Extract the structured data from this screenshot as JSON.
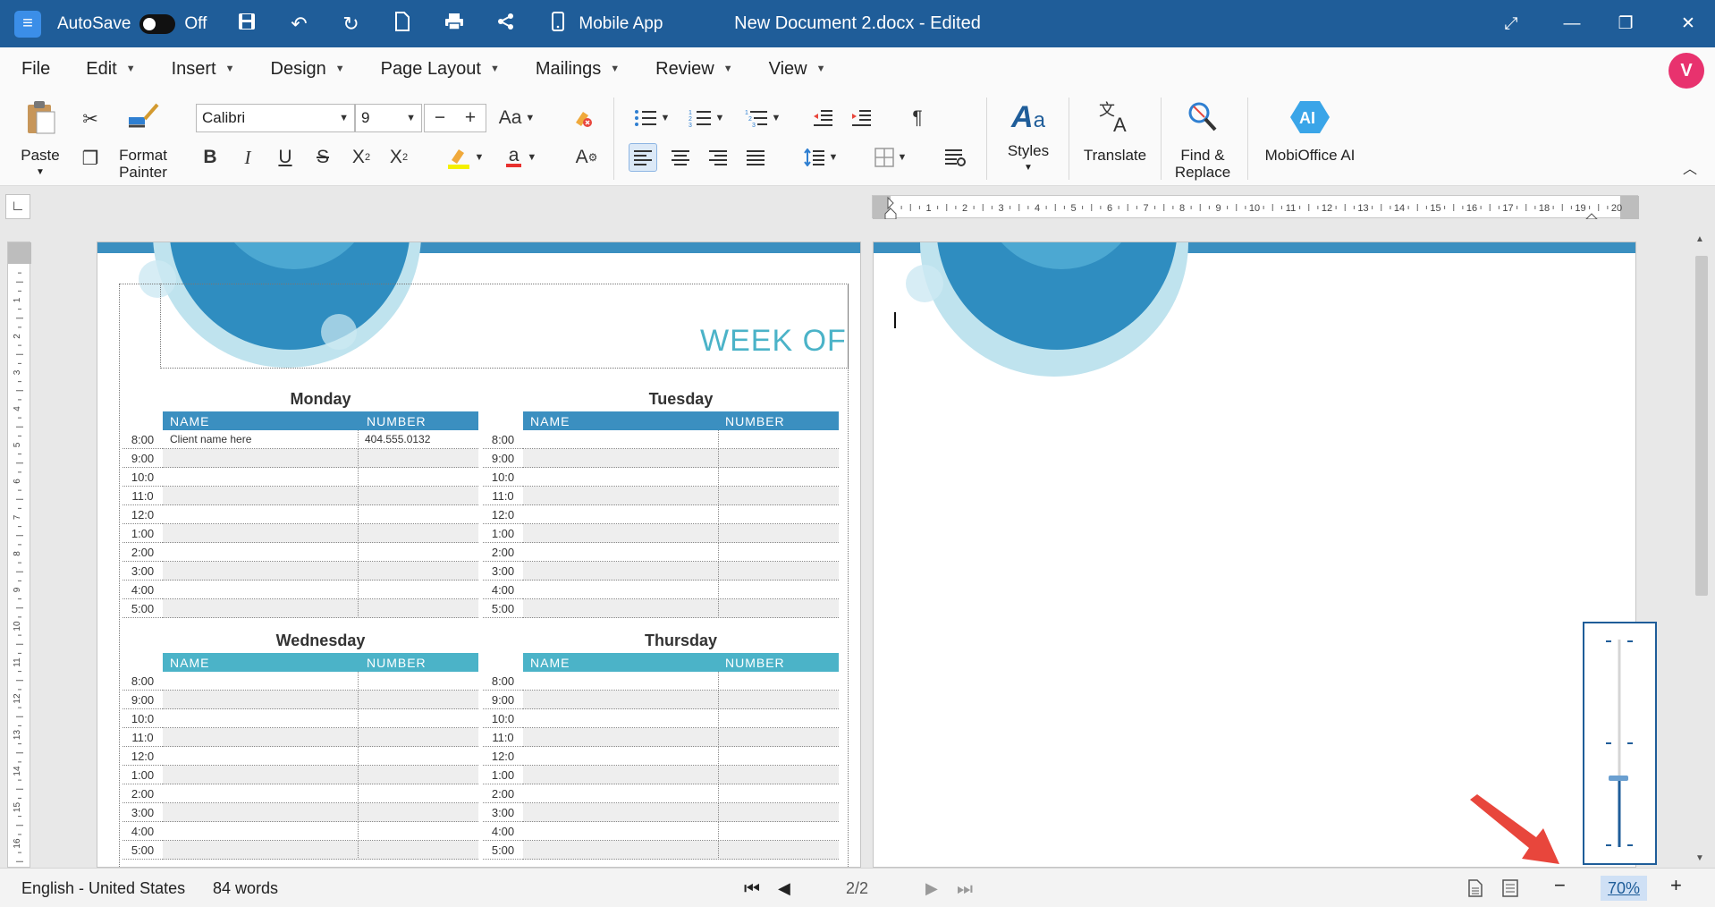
{
  "titlebar": {
    "autosave_label": "AutoSave",
    "autosave_state": "Off",
    "mobile_label": "Mobile App",
    "doc_title": "New Document 2.docx - Edited"
  },
  "menu": [
    {
      "label": "File"
    },
    {
      "label": "Edit"
    },
    {
      "label": "Insert"
    },
    {
      "label": "Design"
    },
    {
      "label": "Page Layout"
    },
    {
      "label": "Mailings"
    },
    {
      "label": "Review"
    },
    {
      "label": "View"
    }
  ],
  "avatar": {
    "initial": "V"
  },
  "ribbon": {
    "paste": "Paste",
    "format_painter_1": "Format",
    "format_painter_2": "Painter",
    "font_name": "Calibri",
    "font_size": "9",
    "styles": "Styles",
    "translate": "Translate",
    "find_replace_1": "Find &",
    "find_replace_2": "Replace",
    "mobioffice_ai": "MobiOffice AI",
    "ai_badge": "AI",
    "font_case_glyph": "Aa"
  },
  "ruler": {
    "numbers": [
      "1",
      "2",
      "3",
      "4",
      "5",
      "6",
      "7",
      "8",
      "9",
      "10",
      "11",
      "12",
      "13",
      "14",
      "15",
      "16",
      "17",
      "18",
      "19",
      "20"
    ]
  },
  "page1": {
    "week_of": "WEEK OF",
    "col_name": "NAME",
    "col_number": "NUMBER",
    "monday": "Monday",
    "tuesday": "Tuesday",
    "wednesday": "Wednesday",
    "thursday": "Thursday",
    "times": [
      "8:00",
      "9:00",
      "10:0",
      "11:0",
      "12:0",
      "1:00",
      "2:00",
      "3:00",
      "4:00",
      "5:00"
    ],
    "monday_first_name": "Client name here",
    "monday_first_number": "404.555.0132"
  },
  "statusbar": {
    "language": "English - United States",
    "words": "84 words",
    "page_counter": "2/2",
    "zoom": "70%"
  },
  "zoom_level_percent": 70,
  "colors": {
    "titlebar": "#1f5d99",
    "band_blue": "#3b8fc0",
    "band_teal": "#4bb3c8",
    "accent_red": "#e8463c"
  }
}
